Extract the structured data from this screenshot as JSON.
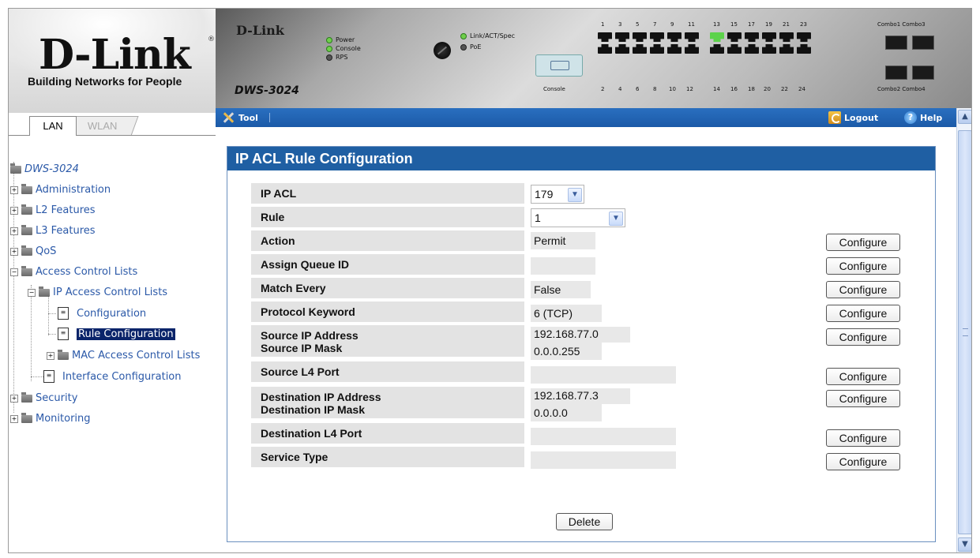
{
  "logo": {
    "brand": "D-Link",
    "registered": "®",
    "tagline": "Building Networks for People"
  },
  "device": {
    "brand": "D-Link",
    "model": "DWS-3024",
    "leds_left": [
      "Power",
      "Console",
      "RPS"
    ],
    "leds_right": [
      "Link/ACT/Spec",
      "PoE"
    ],
    "console_label": "Console",
    "ports_top_nums": [
      "1",
      "3",
      "5",
      "7",
      "9",
      "11",
      "13",
      "15",
      "17",
      "19",
      "21",
      "23"
    ],
    "ports_bottom_nums": [
      "2",
      "4",
      "6",
      "8",
      "10",
      "12",
      "14",
      "16",
      "18",
      "20",
      "22",
      "24"
    ],
    "combo_top": "Combo1 Combo3",
    "combo_bottom": "Combo2 Combo4"
  },
  "tabs": {
    "lan": "LAN",
    "wlan": "WLAN"
  },
  "tree": {
    "root": "DWS-3024",
    "items": {
      "administration": "Administration",
      "l2": "L2 Features",
      "l3": "L3 Features",
      "qos": "QoS",
      "acl": "Access Control Lists",
      "ip_acl": "IP Access Control Lists",
      "configuration": "Configuration",
      "rule_configuration": "Rule Configuration",
      "mac_acl": "MAC Access Control Lists",
      "interface_configuration": "Interface Configuration",
      "security": "Security",
      "monitoring": "Monitoring"
    }
  },
  "toolbar": {
    "tool": "Tool",
    "logout": "Logout",
    "help": "Help"
  },
  "panel": {
    "title": "IP ACL Rule Configuration",
    "ip_acl": {
      "label": "IP ACL",
      "value": "179"
    },
    "rule": {
      "label": "Rule",
      "value": "1"
    },
    "action": {
      "label": "Action",
      "value": "Permit"
    },
    "assign_queue": {
      "label": "Assign Queue ID",
      "value": ""
    },
    "match_every": {
      "label": "Match Every",
      "value": "False"
    },
    "protocol": {
      "label": "Protocol Keyword",
      "value": "6 (TCP)"
    },
    "src_ip": {
      "label": "Source IP Address",
      "value": "192.168.77.0"
    },
    "src_mask": {
      "label": "Source IP Mask",
      "value": "0.0.0.255"
    },
    "src_l4": {
      "label": "Source L4 Port",
      "value": ""
    },
    "dst_ip": {
      "label": "Destination IP Address",
      "value": "192.168.77.3"
    },
    "dst_mask": {
      "label": "Destination IP Mask",
      "value": "0.0.0.0"
    },
    "dst_l4": {
      "label": "Destination L4 Port",
      "value": ""
    },
    "service": {
      "label": "Service Type",
      "value": ""
    },
    "configure_label": "Configure",
    "delete_label": "Delete"
  },
  "icons": {
    "tool": "wrench-icon",
    "logout": "key-icon",
    "help": "question-icon",
    "folder": "folder-icon",
    "document": "document-icon",
    "dropdown": "chevron-down-icon",
    "scroll_up": "scroll-up-arrow",
    "scroll_down": "scroll-down-arrow"
  },
  "colors": {
    "toolbar": "#1b5aa8",
    "panel_header": "#1f5fa3",
    "tree_text": "#2b59a8",
    "selected": "#0a246a"
  }
}
